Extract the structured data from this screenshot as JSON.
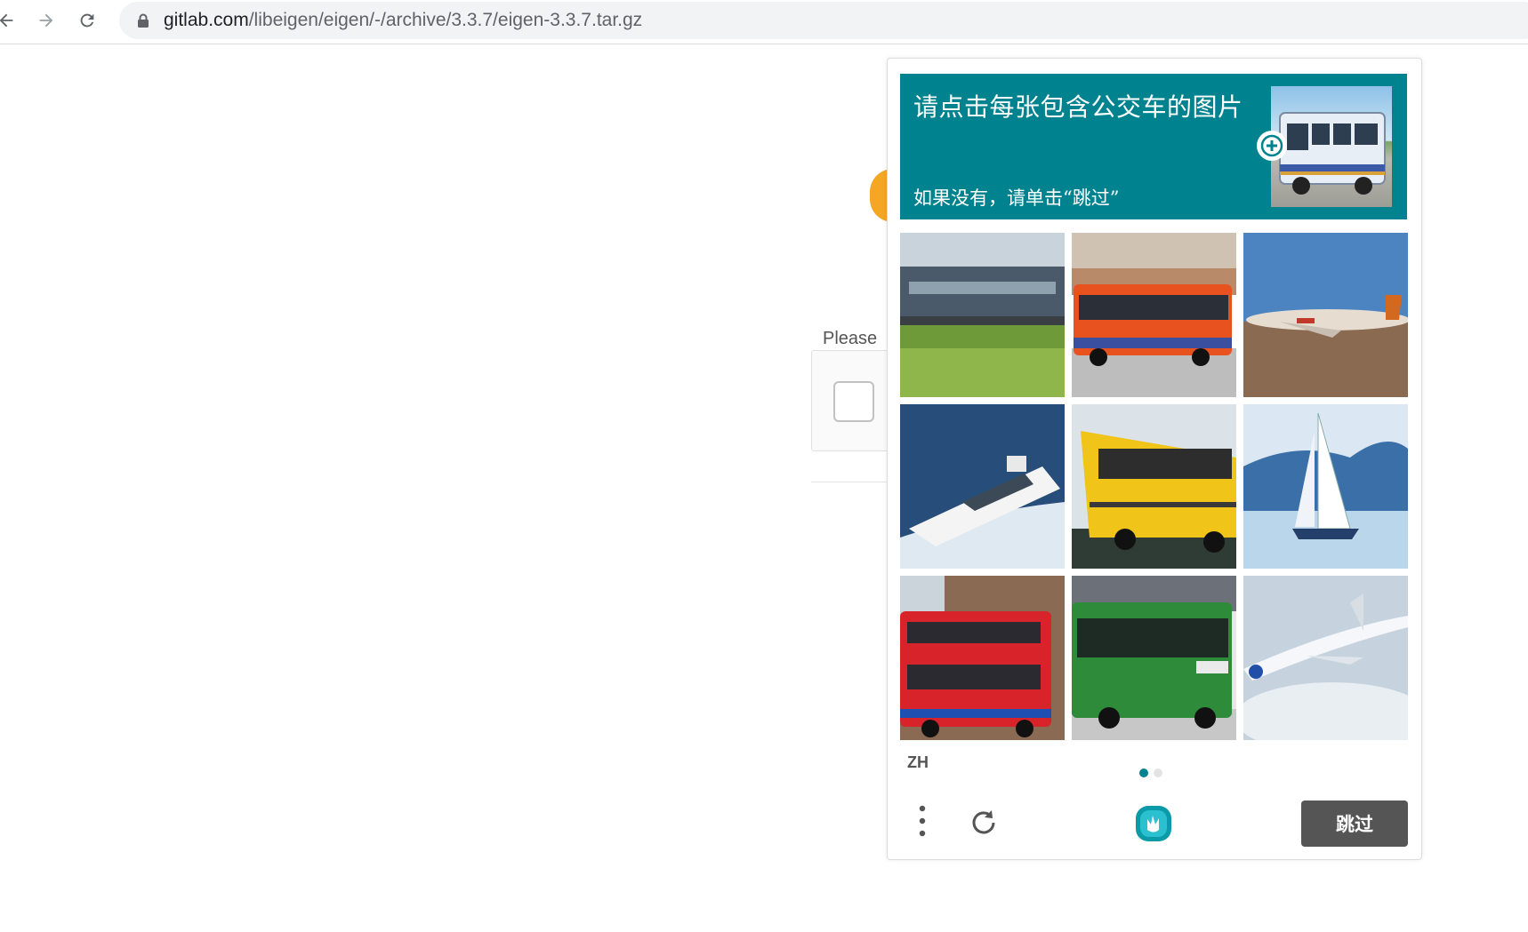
{
  "browser": {
    "url_host": "gitlab.com",
    "url_path": "/libeigen/eigen/-/archive/3.3.7/eigen-3.3.7.tar.gz",
    "icons": [
      "back-arrow-icon",
      "forward-arrow-icon",
      "reload-icon",
      "lock-icon"
    ]
  },
  "page": {
    "prompt_partial": "Please"
  },
  "challenge": {
    "title": "请点击每张包含公交车的图片",
    "subtitle": "如果没有，请单击“跳过”",
    "accent_color": "#00838f",
    "language": "ZH",
    "skip_label": "跳过",
    "page_dots": 2,
    "active_dot": 1,
    "tiles": [
      {
        "subject": "train"
      },
      {
        "subject": "bus"
      },
      {
        "subject": "airplane"
      },
      {
        "subject": "boat"
      },
      {
        "subject": "bus"
      },
      {
        "subject": "sailboat"
      },
      {
        "subject": "bus"
      },
      {
        "subject": "bus"
      },
      {
        "subject": "airplane"
      }
    ]
  }
}
